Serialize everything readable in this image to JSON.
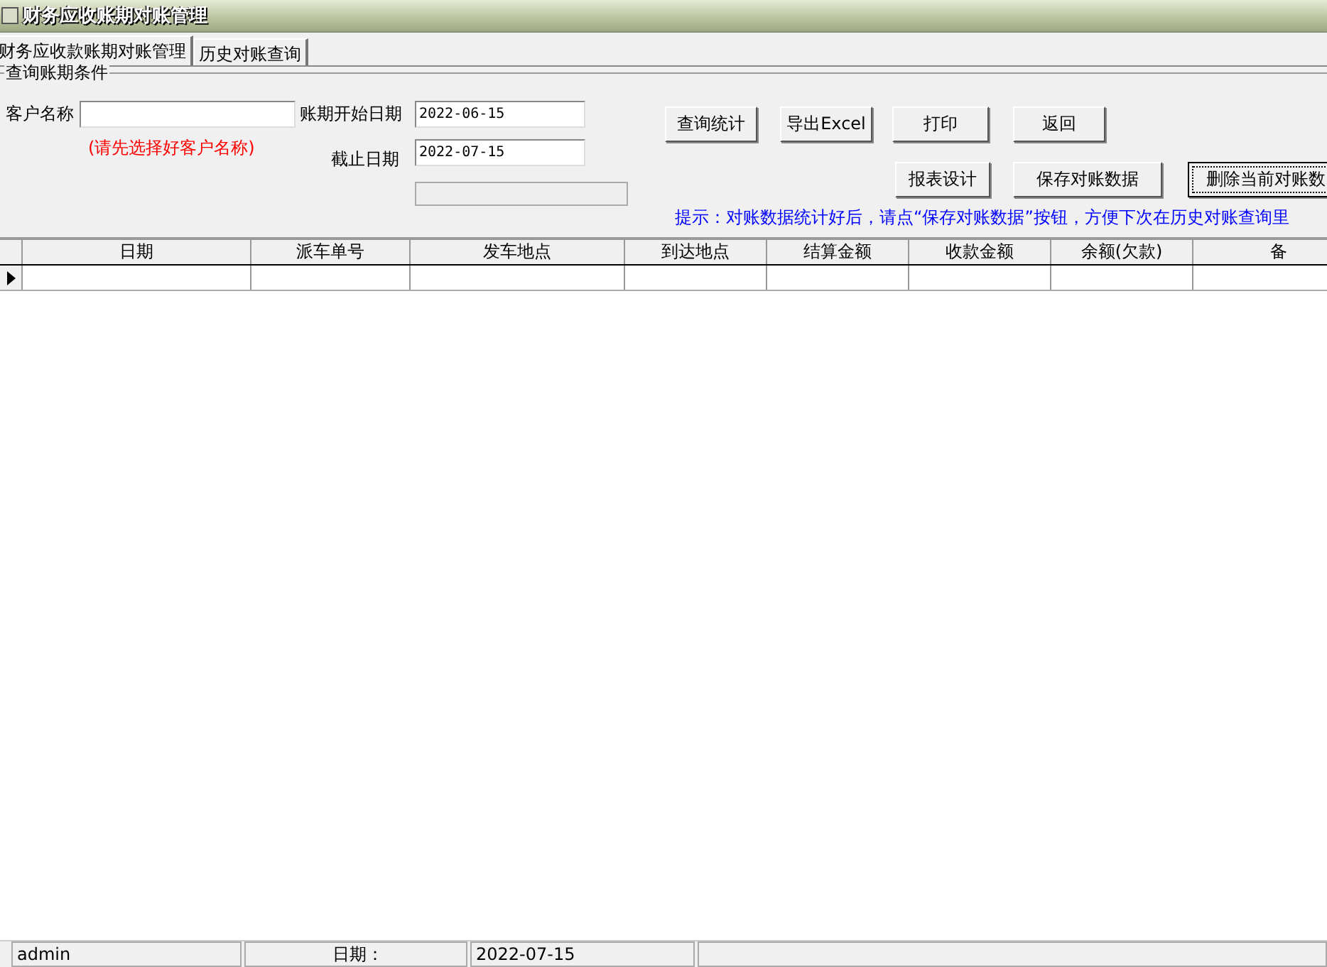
{
  "window": {
    "title": "财务应收账期对账管理"
  },
  "tabs": [
    {
      "label": "财务应收款账期对账管理",
      "selected": true
    },
    {
      "label": "历史对账查询",
      "selected": false
    }
  ],
  "query_group": {
    "title": "查询账期条件",
    "customer": {
      "label": "客户名称",
      "hint": "(请先选择好客户名称)"
    },
    "start_date": {
      "label": "账期开始日期",
      "value": "2022-06-15"
    },
    "end_date": {
      "label": "截止日期",
      "value": "2022-07-15"
    },
    "progress": {
      "level": 0
    },
    "buttons_row1": [
      {
        "label": "查询统计",
        "focused": false
      },
      {
        "label": "导出Excel",
        "focused": false
      },
      {
        "label": "打印",
        "focused": false
      },
      {
        "label": "返回",
        "focused": false
      }
    ],
    "buttons_row2": [
      {
        "label": "报表设计",
        "focused": false
      },
      {
        "label": "保存对账数据",
        "focused": false
      },
      {
        "label": "删除当前对账数",
        "focused": true
      }
    ],
    "tip": "提示：对账数据统计好后，请点“保存对账数据”按钮，方便下次在历史对账查询里"
  },
  "table": {
    "columns": [
      "日期",
      "派车单号",
      "发车地点",
      "到达地点",
      "结算金额",
      "收款金额",
      "余额(欠款)",
      "备"
    ],
    "rows": [
      {
        "current": true
      }
    ]
  },
  "status_bar": {
    "user": "admin",
    "date_label": "日期：",
    "date": "2022-07-15"
  }
}
